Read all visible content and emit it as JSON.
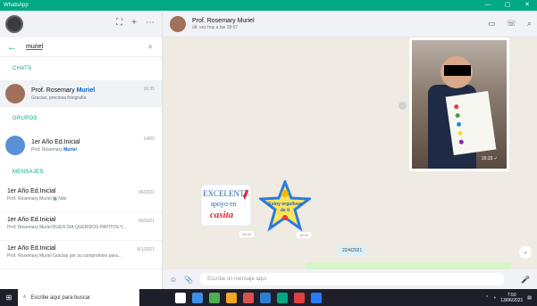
{
  "window": {
    "title": "WhatsApp",
    "controls": [
      "—",
      "▢",
      "✕"
    ]
  },
  "left": {
    "header_icons": [
      "⛶",
      "+",
      "⋯"
    ],
    "search": {
      "value": "muriel",
      "clear": "✕"
    },
    "sections": {
      "chats": "CHATS",
      "groups": "GRUPOS",
      "messages": "MENSAJES"
    },
    "chats": [
      {
        "name_prefix": "Prof. Rosemary",
        "name_match": "Muriel",
        "subtitle": "Gracias, preciosa fotografía",
        "time": "16:35",
        "avatar_color": "#a0705a"
      }
    ],
    "groups": [
      {
        "name": "1er Año Ed.Inicial",
        "sub_prefix": "Prof. Rosemary",
        "sub_match": "Muriel",
        "time": "14/06",
        "avatar_color": "#5b8fd6"
      }
    ],
    "messages": [
      {
        "title": "1er Año Ed.Inicial",
        "subtitle": "Prof. Rosemary Muriel ▦ Ndo",
        "time": "06/2021"
      },
      {
        "title": "1er Año Ed.Inicial",
        "subtitle": "Prof. Rosemary Muriel BUEN DIA QUERIDOS PAPITOS Y...",
        "time": "06/2021"
      },
      {
        "title": "1er Año Ed.Inicial",
        "subtitle": "Prof. Rosemary Muriel Gracias por su compromiso para...",
        "time": "6/1/2021"
      }
    ]
  },
  "right": {
    "contact_name": "Prof. Rosemary Muriel",
    "contact_status": "últ. vez hoy a las 18:07",
    "contact_avatar_color": "#a0705a",
    "header_icons": [
      "▭",
      "☏",
      "⌕"
    ],
    "photo_time": "16:33 ✓",
    "sticker1": {
      "line1": "EXCELENTE",
      "line2": "apoyo en",
      "line3": "casita",
      "time": "16:34"
    },
    "sticker2": {
      "line1": "Estoy orgullosa",
      "line2": "de ti",
      "time": "16:34"
    },
    "date_chip": "22/4/2021",
    "bottom_text": "",
    "input_placeholder": "Escribe un mensaje aquí",
    "emoji_icon": "☺",
    "attach_icon": "📎",
    "mic_icon": "🎤",
    "scroll_icon": "⌄"
  },
  "taskbar": {
    "search_placeholder": "Escribe aquí para buscar",
    "apps": [
      "#ffffff",
      "#3a8ee6",
      "#4caf50",
      "#f5a623",
      "#d9534f",
      "#2d7fd3",
      "#00a884",
      "#e04040",
      "#2979ff"
    ],
    "tray_time": "7:50",
    "tray_date": "13/06/2021"
  }
}
